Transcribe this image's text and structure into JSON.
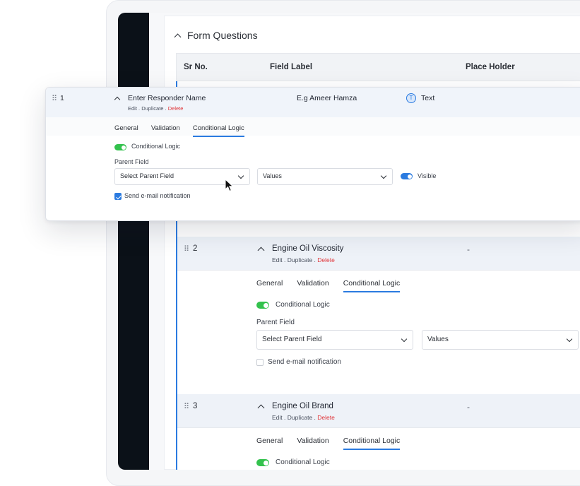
{
  "panel": {
    "title": "Form Questions"
  },
  "table": {
    "headers": [
      "Sr No.",
      "Field Label",
      "Place Holder"
    ]
  },
  "card": {
    "sr": "1",
    "label": "Enter Responder Name",
    "placeholder": "E.g Ameer Hamza",
    "type_badge": "T",
    "type": "Text",
    "actions": {
      "edit": "Edit",
      "duplicate": "Duplicate",
      "delete": "Delete",
      "sep": " . "
    },
    "tabs": [
      "General",
      "Validation",
      "Conditional Logic"
    ],
    "active_tab": "Conditional Logic",
    "toggle_label": "Conditional Logic",
    "parent_field_label": "Parent Field",
    "parent_select": "Select Parent Field",
    "values_select": "Values",
    "visible_label": "Visible",
    "notify_label": "Send e-mail notification",
    "notify_checked": true
  },
  "rows": [
    {
      "sr": "2",
      "label": "Engine Oil Viscosity",
      "placeholder": "-",
      "actions": {
        "edit": "Edit",
        "duplicate": "Duplicate",
        "delete": "Delete",
        "sep": " . "
      },
      "tabs": [
        "General",
        "Validation",
        "Conditional Logic"
      ],
      "toggle_label": "Conditional Logic",
      "parent_field_label": "Parent Field",
      "parent_select": "Select Parent Field",
      "values_select": "Values",
      "notify_label": "Send e-mail notification",
      "notify_checked": false
    },
    {
      "sr": "3",
      "label": "Engine Oil Brand",
      "placeholder": "-",
      "actions": {
        "edit": "Edit",
        "duplicate": "Duplicate",
        "delete": "Delete",
        "sep": " . "
      },
      "tabs": [
        "General",
        "Validation",
        "Conditional Logic"
      ],
      "toggle_label": "Conditional Logic"
    }
  ],
  "colors": {
    "accent": "#2b7be0",
    "toggle_on": "#33c24d",
    "delete": "#e0373b",
    "sidebar": "#0b1118"
  }
}
